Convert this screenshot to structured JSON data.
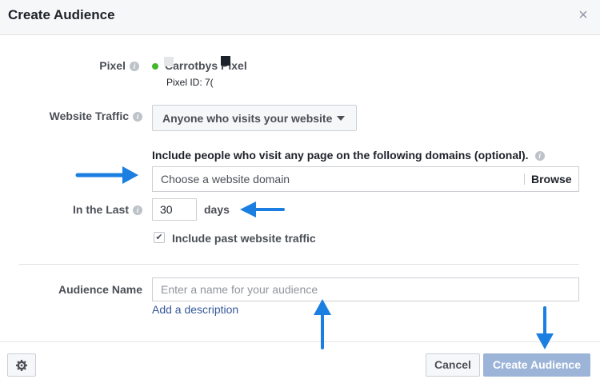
{
  "dialog": {
    "title": "Create Audience",
    "close_symbol": "×"
  },
  "pixel": {
    "label": "Pixel",
    "name": "Carrotbys Pixel",
    "id_label": "Pixel ID: 7(",
    "status_color": "#42b72a"
  },
  "traffic": {
    "label": "Website Traffic",
    "selected": "Anyone who visits your website",
    "include_text": "Include people who visit any page on the following domains (optional).",
    "domain_placeholder": "Choose a website domain",
    "browse_label": "Browse"
  },
  "in_the_last": {
    "label": "In the Last",
    "value": "30",
    "unit": "days"
  },
  "past_traffic": {
    "label": "Include past website traffic",
    "checked": true,
    "check_symbol": "✔"
  },
  "audience_name": {
    "label": "Audience Name",
    "placeholder": "Enter a name for your audience",
    "value": "",
    "add_description": "Add a description"
  },
  "footer": {
    "cancel_label": "Cancel",
    "create_label": "Create Audience"
  },
  "info_symbol": "i",
  "colors": {
    "arrow": "#1a7fe0",
    "link": "#365899",
    "create_button": "#9cb4d8"
  }
}
